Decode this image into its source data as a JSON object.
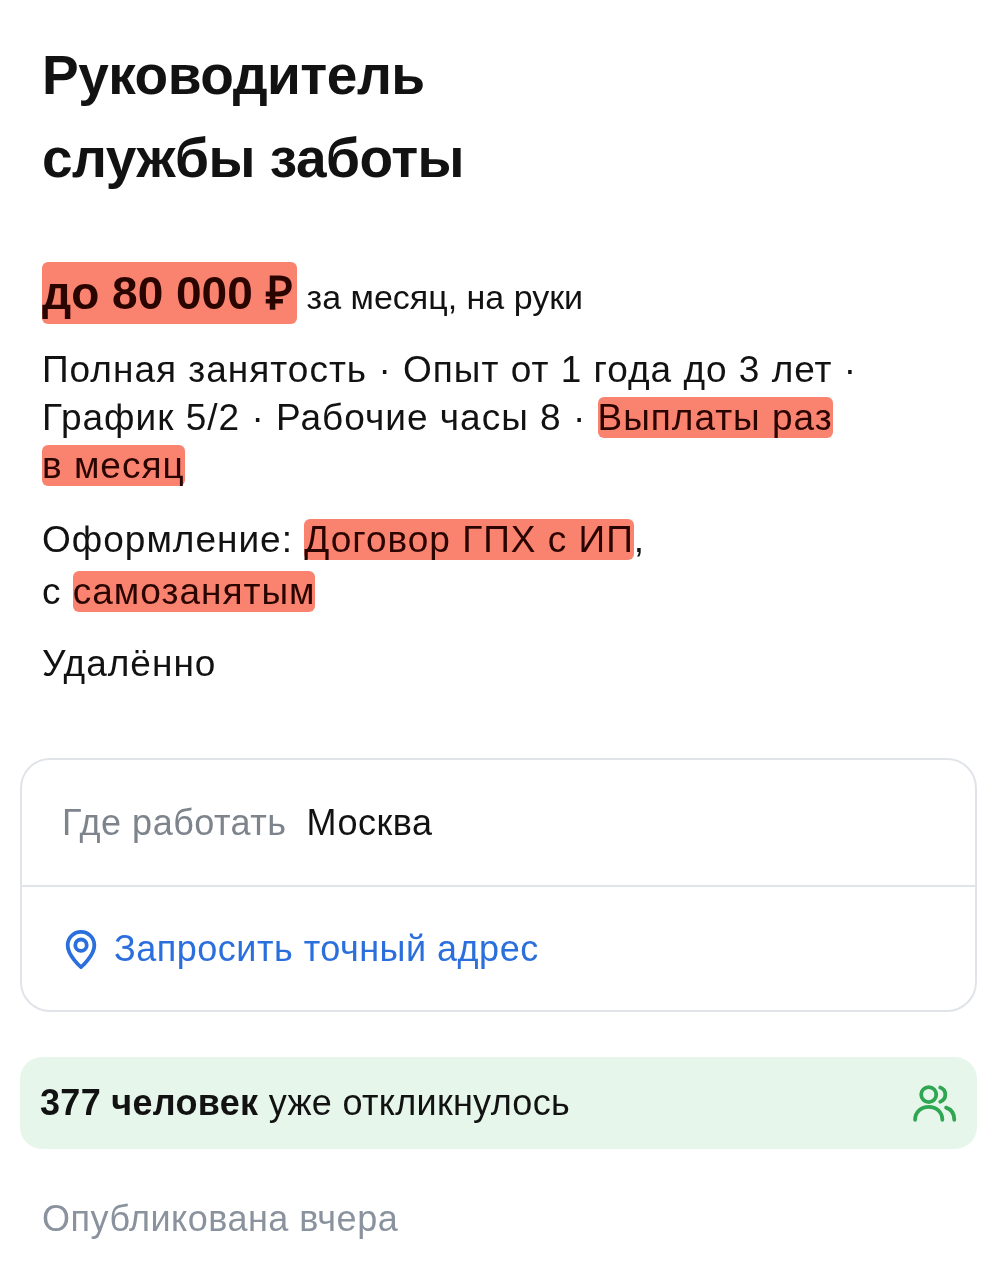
{
  "title": "Руководитель службы заботы",
  "salary": {
    "amount": "до 80 000 ₽",
    "amount_highlighted": true,
    "period": "за месяц, на руки"
  },
  "conditions": [
    {
      "text": "Полная занятость ·",
      "highlighted": false
    },
    {
      "text": "Опыт от 1 года до 3 лет ·",
      "highlighted": false
    },
    {
      "text": "График 5/2 ·",
      "highlighted": false
    },
    {
      "text": "Рабочие часы 8 ·",
      "highlighted": false
    },
    {
      "text": "Выплаты раз в месяц",
      "highlighted": true
    }
  ],
  "employment": [
    {
      "text": "Оформление: ",
      "highlighted": false
    },
    {
      "text": "Договор ГПХ с ИП",
      "highlighted": true
    },
    {
      "text": ", с ",
      "highlighted": false
    },
    {
      "text": "самозанятым",
      "highlighted": true
    }
  ],
  "work_format": "Удалённо",
  "location": {
    "label": "Где работать",
    "city": "Москва",
    "address_link": "Запросить точный адрес"
  },
  "responses": {
    "count": "377 человек",
    "text": "уже откликнулось"
  },
  "published": "Опубликована вчера"
}
